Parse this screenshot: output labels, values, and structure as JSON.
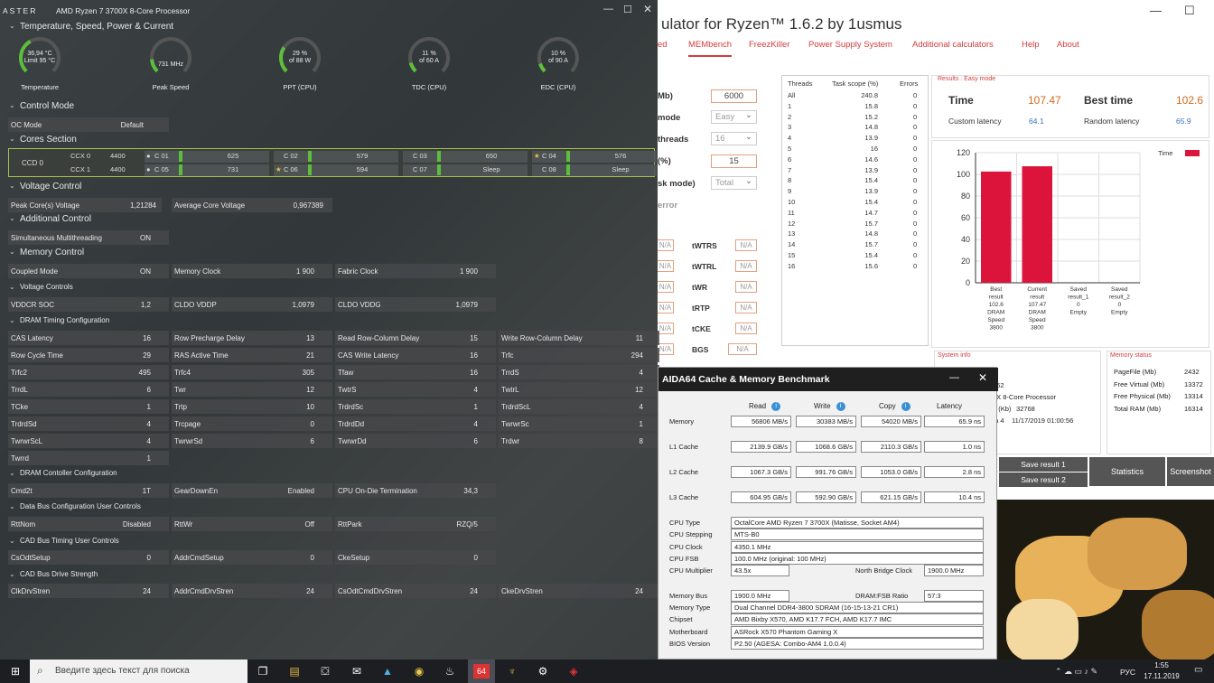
{
  "ryzen": {
    "app_label": "ASTER",
    "processor": "AMD Ryzen 7 3700X 8-Core Processor",
    "sections": {
      "temp": "Temperature, Speed, Power & Current",
      "control": "Control Mode",
      "cores": "Cores Section",
      "voltage": "Voltage Control",
      "additional": "Additional Control",
      "memory": "Memory Control",
      "volt_controls": "Voltage Controls",
      "dram_timing": "DRAM Timing Configuration",
      "dram_controller": "DRAM Contoller Configuration",
      "data_bus": "Data Bus Configuration User Controls",
      "cad_timing": "CAD Bus Timing User Controls",
      "cad_drive": "CAD Bus Drive Strength"
    },
    "gauges": [
      {
        "line1": "36,94 °C",
        "line2": "Limit 95 °C",
        "label": "Temperature",
        "pct": 0.39
      },
      {
        "line1": "731  MHz",
        "line2": "",
        "label": "Peak Speed",
        "pct": 0.15
      },
      {
        "line1": "29 %",
        "line2": "of 88 W",
        "label": "PPT (CPU)",
        "pct": 0.29
      },
      {
        "line1": "11 %",
        "line2": "of 60 A",
        "label": "TDC (CPU)",
        "pct": 0.11
      },
      {
        "line1": "10 %",
        "line2": "of 90 A",
        "label": "EDC (CPU)",
        "pct": 0.1
      }
    ],
    "oc_mode": {
      "label": "OC Mode",
      "value": "Default"
    },
    "ccd": "CCD 0",
    "ccx": [
      {
        "name": "CCX 0",
        "freq": "4400",
        "cores": [
          {
            "n": "C 01",
            "v": "625",
            "mark": "●"
          },
          {
            "n": "C 02",
            "v": "579",
            "mark": ""
          },
          {
            "n": "C 03",
            "v": "650",
            "mark": ""
          },
          {
            "n": "C 04",
            "v": "576",
            "mark": "★"
          }
        ]
      },
      {
        "name": "CCX 1",
        "freq": "4400",
        "cores": [
          {
            "n": "C 05",
            "v": "731",
            "mark": "●"
          },
          {
            "n": "C 06",
            "v": "594",
            "mark": "★"
          },
          {
            "n": "C 07",
            "v": "Sleep",
            "mark": ""
          },
          {
            "n": "C 08",
            "v": "Sleep",
            "mark": ""
          }
        ]
      }
    ],
    "voltage": [
      {
        "l": "Peak Core(s) Voltage",
        "v": "1,21284"
      },
      {
        "l": "Average Core Voltage",
        "v": "0,967389"
      }
    ],
    "smt": {
      "l": "Simultaneous Multithreading",
      "v": "ON"
    },
    "memory": [
      {
        "l": "Coupled Mode",
        "v": "ON"
      },
      {
        "l": "Memory Clock",
        "v": "1 900"
      },
      {
        "l": "Fabric Clock",
        "v": "1 900"
      }
    ],
    "volt_ctrl": [
      {
        "l": "VDDCR SOC",
        "v": "1,2"
      },
      {
        "l": "CLDO VDDP",
        "v": "1,0979"
      },
      {
        "l": "CLDO VDDG",
        "v": "1,0979"
      }
    ],
    "timings": [
      [
        {
          "l": "CAS Latency",
          "v": "16"
        },
        {
          "l": "Row Precharge Delay",
          "v": "13"
        },
        {
          "l": "Read Row-Column Delay",
          "v": "15"
        },
        {
          "l": "Write Row-Column Delay",
          "v": "11"
        }
      ],
      [
        {
          "l": "Row Cycle Time",
          "v": "29"
        },
        {
          "l": "RAS Active Time",
          "v": "21"
        },
        {
          "l": "CAS Write Latency",
          "v": "16"
        },
        {
          "l": "Trfc",
          "v": "294"
        }
      ],
      [
        {
          "l": "Trfc2",
          "v": "495"
        },
        {
          "l": "Trfc4",
          "v": "305"
        },
        {
          "l": "Tfaw",
          "v": "16"
        },
        {
          "l": "TrrdS",
          "v": "4"
        }
      ],
      [
        {
          "l": "TrrdL",
          "v": "6"
        },
        {
          "l": "Twr",
          "v": "12"
        },
        {
          "l": "TwtrS",
          "v": "4"
        },
        {
          "l": "TwtrL",
          "v": "12"
        }
      ],
      [
        {
          "l": "TCke",
          "v": "1"
        },
        {
          "l": "Trtp",
          "v": "10"
        },
        {
          "l": "TrdrdSc",
          "v": "1"
        },
        {
          "l": "TrdrdScL",
          "v": "4"
        }
      ],
      [
        {
          "l": "TrdrdSd",
          "v": "4"
        },
        {
          "l": "Trcpage",
          "v": "0"
        },
        {
          "l": "TrdrdDd",
          "v": "4"
        },
        {
          "l": "TwrwrSc",
          "v": "1"
        }
      ],
      [
        {
          "l": "TwrwrScL",
          "v": "4"
        },
        {
          "l": "TwrwrSd",
          "v": "6"
        },
        {
          "l": "TwrwrDd",
          "v": "6"
        },
        {
          "l": "Trdwr",
          "v": "8"
        }
      ],
      [
        {
          "l": "Twrrd",
          "v": "1"
        }
      ]
    ],
    "controller": [
      {
        "l": "Cmd2t",
        "v": "1T"
      },
      {
        "l": "GearDownEn",
        "v": "Enabled"
      },
      {
        "l": "CPU On-Die Termination",
        "v": "34,3"
      }
    ],
    "databus": [
      {
        "l": "RttNom",
        "v": "Disabled"
      },
      {
        "l": "RttWr",
        "v": "Off"
      },
      {
        "l": "RttPark",
        "v": "RZQ/5"
      }
    ],
    "cadtiming": [
      {
        "l": "CsOdtSetup",
        "v": "0"
      },
      {
        "l": "AddrCmdSetup",
        "v": "0"
      },
      {
        "l": "CkeSetup",
        "v": "0"
      }
    ],
    "caddrive": [
      {
        "l": "ClkDrvStren",
        "v": "24"
      },
      {
        "l": "AddrCmdDrvStren",
        "v": "24"
      },
      {
        "l": "CsOdtCmdDrvStren",
        "v": "24"
      },
      {
        "l": "CkeDrvStren",
        "v": "24"
      }
    ]
  },
  "dram": {
    "title": "ulator for Ryzen™ 1.6.2 by 1usmus",
    "menu": [
      "ed",
      "MEMbench",
      "FreezKiller",
      "Power Supply System",
      "Additional calculators",
      "Help",
      "About"
    ],
    "labels": {
      "mb": "Mb)",
      "mode": "mode",
      "threads": "threads",
      "pct": "(%)",
      "task": "sk mode)",
      "error": "error"
    },
    "inputs": {
      "mb": "6000",
      "mode": "Easy",
      "threads": "16",
      "pct": "15",
      "task": "Total"
    },
    "timings": [
      "tWTRS",
      "tWTRL",
      "tWR",
      "tRTP",
      "tCKE",
      "BGS"
    ],
    "na": "N/A",
    "thr_headers": [
      "Threads",
      "Task scope (%)",
      "Errors"
    ],
    "thr_rows": [
      [
        "All",
        "240.8",
        "0"
      ],
      [
        "1",
        "15.8",
        "0"
      ],
      [
        "2",
        "15.2",
        "0"
      ],
      [
        "3",
        "14.8",
        "0"
      ],
      [
        "4",
        "13.9",
        "0"
      ],
      [
        "5",
        "16",
        "0"
      ],
      [
        "6",
        "14.6",
        "0"
      ],
      [
        "7",
        "13.9",
        "0"
      ],
      [
        "8",
        "15.4",
        "0"
      ],
      [
        "9",
        "13.9",
        "0"
      ],
      [
        "10",
        "15.4",
        "0"
      ],
      [
        "11",
        "14.7",
        "0"
      ],
      [
        "12",
        "15.7",
        "0"
      ],
      [
        "13",
        "14.8",
        "0"
      ],
      [
        "14",
        "15.7",
        "0"
      ],
      [
        "15",
        "15.4",
        "0"
      ],
      [
        "16",
        "15.6",
        "0"
      ]
    ],
    "results_title": "Results : Easy mode",
    "time_label": "Time",
    "time": "107.47",
    "best_label": "Best time",
    "best": "102.6",
    "custom_label": "Custom latency",
    "custom": "64.1",
    "random_label": "Random latency",
    "random": "65.9",
    "chart_legend": "Time",
    "sysinfo": "System info",
    "memstatus": "Memory status",
    "sys_lines": [
      "362",
      "0X 8-Core Processor",
      "o (Kb)",
      "ta 4"
    ],
    "sys_vals": [
      "32768",
      "11/17/2019 01:00:56"
    ],
    "mem_lines": [
      {
        "l": "PageFile (Mb)",
        "v": "2432"
      },
      {
        "l": "Free Virtual (Mb)",
        "v": "13372"
      },
      {
        "l": "Free Physical (Mb)",
        "v": "13314"
      },
      {
        "l": "Total RAM (Mb)",
        "v": "16314"
      }
    ],
    "buttons": [
      "Save result 1",
      "Save result 2",
      "Statistics",
      "Screenshot"
    ]
  },
  "chart_data": {
    "type": "bar",
    "categories": [
      "Best result 102.6 DRAM Speed 3800",
      "Current result 107.47 DRAM Speed 3800",
      "Saved result_1 0 Empty",
      "Saved result_2 0 Empty"
    ],
    "cat_lines": [
      [
        "Best",
        "result",
        "102.6",
        "DRAM",
        "Speed",
        "3800"
      ],
      [
        "Current",
        "result",
        "107.47",
        "DRAM",
        "Speed",
        "3800"
      ],
      [
        "Saved",
        "result_1",
        "0",
        "Empty"
      ],
      [
        "Saved",
        "result_2",
        "0",
        "Empty"
      ]
    ],
    "series": [
      {
        "name": "Time",
        "values": [
          102.6,
          107.47,
          0,
          0
        ]
      }
    ],
    "ylim": [
      0,
      120
    ],
    "yticks": [
      "0",
      "20",
      "40",
      "60",
      "80",
      "100",
      "120"
    ],
    "colors": {
      "bar": "#dc143c"
    }
  },
  "aida": {
    "title": "AIDA64 Cache & Memory Benchmark",
    "cols": [
      "Read",
      "Write",
      "Copy",
      "Latency"
    ],
    "rows": [
      {
        "l": "Memory",
        "v": [
          "56806 MB/s",
          "30383 MB/s",
          "54020 MB/s",
          "65.9 ns"
        ]
      },
      {
        "l": "L1 Cache",
        "v": [
          "2139.9 GB/s",
          "1068.6 GB/s",
          "2110.3 GB/s",
          "1.0 ns"
        ]
      },
      {
        "l": "L2 Cache",
        "v": [
          "1067.3 GB/s",
          "991.76 GB/s",
          "1053.0 GB/s",
          "2.8 ns"
        ]
      },
      {
        "l": "L3 Cache",
        "v": [
          "604.95 GB/s",
          "592.90 GB/s",
          "621.15 GB/s",
          "10.4 ns"
        ]
      }
    ],
    "info": [
      {
        "l": "CPU Type",
        "v": "OctalCore AMD Ryzen 7 3700X  (Matisse, Socket AM4)"
      },
      {
        "l": "CPU Stepping",
        "v": "MTS-B0"
      },
      {
        "l": "CPU Clock",
        "v": "4350.1 MHz"
      },
      {
        "l": "CPU FSB",
        "v": "100.0 MHz  (original: 100 MHz)"
      }
    ],
    "mult_l": "CPU Multiplier",
    "mult": "43.5x",
    "nb_l": "North Bridge Clock",
    "nb": "1900.0 MHz",
    "bus_l": "Memory Bus",
    "bus": "1900.0 MHz",
    "ratio_l": "DRAM:FSB Ratio",
    "ratio": "57:3",
    "info2": [
      {
        "l": "Memory Type",
        "v": "Dual Channel DDR4-3800 SDRAM  (16-15-13-21 CR1)"
      },
      {
        "l": "Chipset",
        "v": "AMD Bixby X570, AMD K17.7 FCH, AMD K17.7 IMC"
      },
      {
        "l": "Motherboard",
        "v": "ASRock X570 Phantom Gaming X"
      },
      {
        "l": "BIOS Version",
        "v": "P2.50  (AGESA: Combo-AM4 1.0.0.4)"
      }
    ]
  },
  "taskbar": {
    "search": "Введите здесь текст для поиска",
    "lang": "РУС",
    "time": "1:55",
    "date": "17.11.2019"
  }
}
